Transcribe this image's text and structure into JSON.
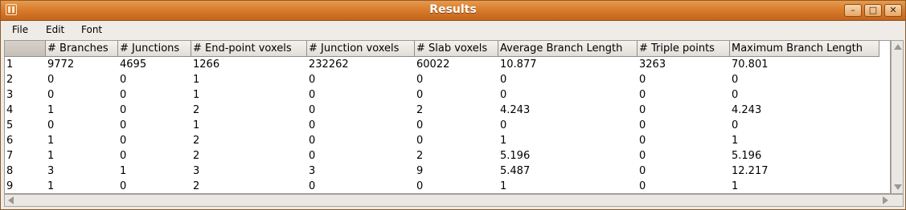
{
  "window": {
    "title": "Results"
  },
  "menu": [
    "File",
    "Edit",
    "Font"
  ],
  "table": {
    "columns": [
      "",
      "# Branches",
      "# Junctions",
      "# End-point voxels",
      "# Junction voxels",
      "# Slab voxels",
      "Average Branch Length",
      "# Triple points",
      "Maximum Branch Length"
    ],
    "rows": [
      [
        "1",
        "9772",
        "4695",
        "1266",
        "232262",
        "60022",
        "10.877",
        "3263",
        "70.801"
      ],
      [
        "2",
        "0",
        "0",
        "1",
        "0",
        "0",
        "0",
        "0",
        "0"
      ],
      [
        "3",
        "0",
        "0",
        "1",
        "0",
        "0",
        "0",
        "0",
        "0"
      ],
      [
        "4",
        "1",
        "0",
        "2",
        "0",
        "2",
        "4.243",
        "0",
        "4.243"
      ],
      [
        "5",
        "0",
        "0",
        "1",
        "0",
        "0",
        "0",
        "0",
        "0"
      ],
      [
        "6",
        "1",
        "0",
        "2",
        "0",
        "0",
        "1",
        "0",
        "1"
      ],
      [
        "7",
        "1",
        "0",
        "2",
        "0",
        "2",
        "5.196",
        "0",
        "5.196"
      ],
      [
        "8",
        "3",
        "1",
        "3",
        "3",
        "9",
        "5.487",
        "0",
        "12.217"
      ],
      [
        "9",
        "1",
        "0",
        "2",
        "0",
        "0",
        "1",
        "0",
        "1"
      ]
    ]
  }
}
